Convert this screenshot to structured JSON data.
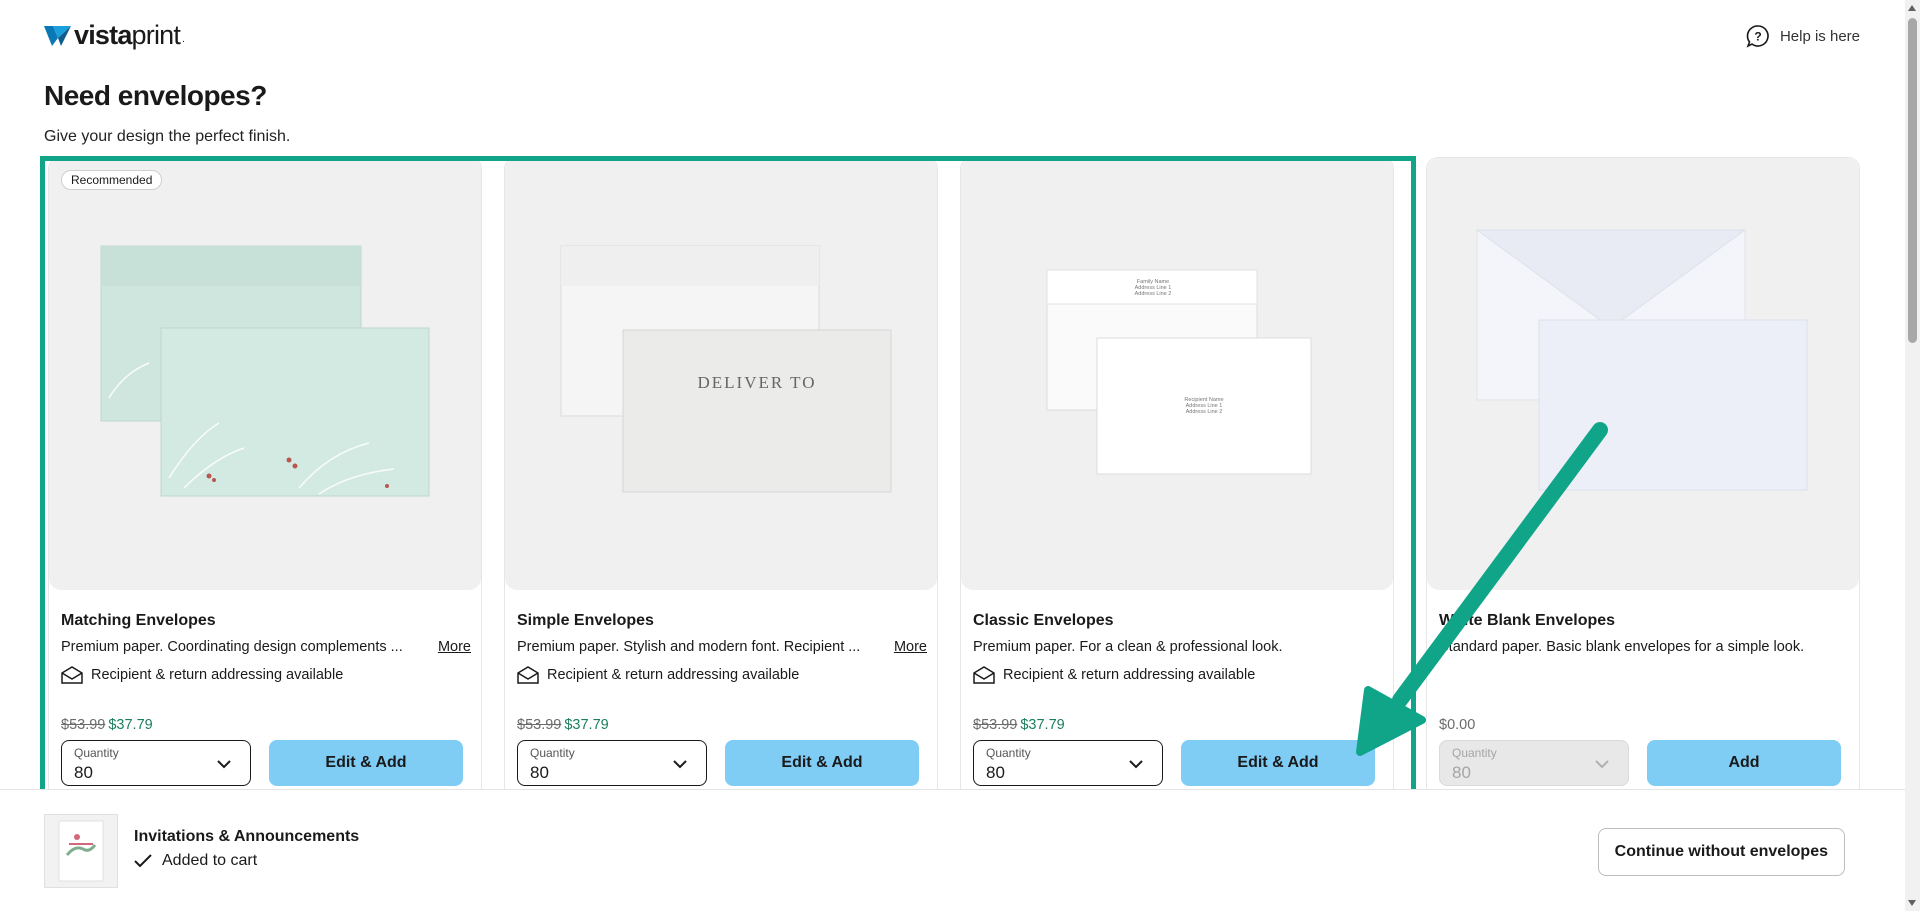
{
  "header": {
    "logo_text_bold": "vista",
    "logo_text_light": "print",
    "logo_dot": ".",
    "help_label": "Help is here"
  },
  "page": {
    "title": "Need envelopes?",
    "subtitle": "Give your design the perfect finish."
  },
  "cards": [
    {
      "badge": "Recommended",
      "title": "Matching Envelopes",
      "description": "Premium paper. Coordinating design complements ...",
      "more_label": "More",
      "feature": "Recipient & return addressing available",
      "price_old": "$53.99",
      "price_new": "$37.79",
      "quantity_label": "Quantity",
      "quantity_value": "80",
      "button_label": "Edit & Add"
    },
    {
      "title": "Simple Envelopes",
      "description": "Premium paper. Stylish and modern font. Recipient ...",
      "more_label": "More",
      "feature": "Recipient & return addressing available",
      "price_old": "$53.99",
      "price_new": "$37.79",
      "quantity_label": "Quantity",
      "quantity_value": "80",
      "button_label": "Edit & Add",
      "envelope_text": "DELIVER TO"
    },
    {
      "title": "Classic Envelopes",
      "description": "Premium paper. For a clean & professional look.",
      "feature": "Recipient & return addressing available",
      "price_old": "$53.99",
      "price_new": "$37.79",
      "quantity_label": "Quantity",
      "quantity_value": "80",
      "button_label": "Edit & Add",
      "return_address": [
        "Family Name",
        "Address Line 1",
        "Address Line 2"
      ],
      "recipient_address": [
        "Recipient Name",
        "Address Line 1",
        "Address Line 2"
      ]
    },
    {
      "title": "White Blank Envelopes",
      "description": "Standard paper. Basic blank envelopes for a simple look.",
      "price": "$0.00",
      "quantity_label": "Quantity",
      "quantity_value": "80",
      "button_label": "Add"
    }
  ],
  "footer": {
    "product_title": "Invitations & Announcements",
    "status": "Added to cart",
    "continue_label": "Continue without envelopes"
  },
  "colors": {
    "accent_button": "#7fccf5",
    "sale_price": "#1a7f5a",
    "annotation": "#10a588"
  }
}
